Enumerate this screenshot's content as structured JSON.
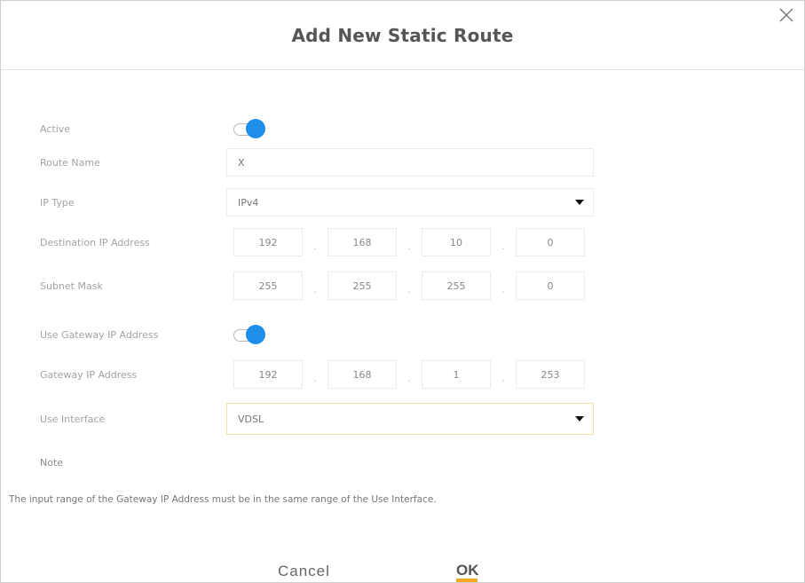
{
  "dialog": {
    "title": "Add New Static Route",
    "close_icon": "close-icon"
  },
  "form": {
    "active": {
      "label": "Active",
      "enabled": true
    },
    "route_name": {
      "label": "Route Name",
      "value": "X"
    },
    "ip_type": {
      "label": "IP Type",
      "value": "IPv4"
    },
    "destination_ip": {
      "label": "Destination IP Address",
      "octets": [
        "192",
        "168",
        "10",
        "0"
      ]
    },
    "subnet_mask": {
      "label": "Subnet Mask",
      "octets": [
        "255",
        "255",
        "255",
        "0"
      ]
    },
    "use_gateway": {
      "label": "Use Gateway IP Address",
      "enabled": true
    },
    "gateway_ip": {
      "label": "Gateway IP Address",
      "octets": [
        "192",
        "168",
        "1",
        "253"
      ]
    },
    "use_interface": {
      "label": "Use Interface",
      "value": "VDSL"
    }
  },
  "note": {
    "title": "Note",
    "text": "The input range of the Gateway IP Address must be in the same range of the Use Interface."
  },
  "buttons": {
    "cancel": "Cancel",
    "ok": "OK"
  },
  "colors": {
    "toggle_on": "#1e8ee8",
    "ok_accent": "#f5a623"
  }
}
